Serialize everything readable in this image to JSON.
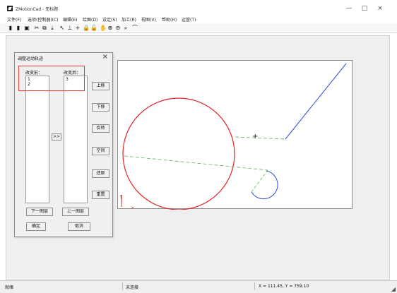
{
  "window": {
    "title": "ZMotionCad - 无标题",
    "minimize": "—",
    "maximize": "□",
    "close": "×"
  },
  "menu": {
    "items": [
      {
        "label": "文件(F)"
      },
      {
        "label": "选项(控制器)(C)"
      },
      {
        "label": "编辑(E)"
      },
      {
        "label": "绘图(D)"
      },
      {
        "label": "设定(S)"
      },
      {
        "label": "加工(R)"
      },
      {
        "label": "视图(V)"
      },
      {
        "label": "帮助(H)"
      },
      {
        "label": "运营(T)"
      }
    ]
  },
  "toolbar": {
    "icons": [
      {
        "name": "new-file-icon",
        "glyph": "▮"
      },
      {
        "name": "open-file-icon",
        "glyph": "▮"
      },
      {
        "name": "save-icon",
        "glyph": "▣"
      },
      {
        "name": "cut-icon",
        "glyph": "✂"
      },
      {
        "name": "copy-icon",
        "glyph": "⧉"
      },
      {
        "name": "download-icon",
        "glyph": "⤓"
      },
      {
        "name": "select-icon",
        "glyph": "↖"
      },
      {
        "name": "measure-icon",
        "glyph": "⊥"
      },
      {
        "name": "cross-icon",
        "glyph": "+"
      },
      {
        "name": "lock-icon",
        "glyph": "🔒"
      },
      {
        "name": "unlock-icon",
        "glyph": "🔓"
      },
      {
        "name": "hand-icon",
        "glyph": "✋"
      },
      {
        "name": "zoom-in-icon",
        "glyph": "⊕"
      },
      {
        "name": "zoom-out-icon",
        "glyph": "⊖"
      },
      {
        "name": "zoom-extent-icon",
        "glyph": "⌕"
      },
      {
        "name": "arc-icon",
        "glyph": "⌒"
      }
    ]
  },
  "dialog": {
    "title": "调整运动轨迹",
    "close": "×",
    "before_label": "改变前：",
    "after_label": "改变后：",
    "before_items": [
      "1",
      "2"
    ],
    "after_items": [
      "3"
    ],
    "move_button": ">>",
    "buttons": {
      "up": "上移",
      "down": "下移",
      "reverse": "反转",
      "empty": "空间",
      "restore": "还原",
      "reset": "重置",
      "next_layer": "下一图层",
      "prev_layer": "上一图层",
      "ok": "确定",
      "cancel": "取消"
    }
  },
  "canvas": {
    "cursor": "+",
    "axis_x": ">",
    "axis_y": "↑"
  },
  "status": {
    "ready": "就绪",
    "mode": "未连接",
    "coords": "X = 111.45, Y = 759.10"
  },
  "colors": {
    "highlight": "#e53a3a",
    "circle": "#e02424",
    "path_blue": "#2e4fd6",
    "path_green": "#59b85a"
  }
}
